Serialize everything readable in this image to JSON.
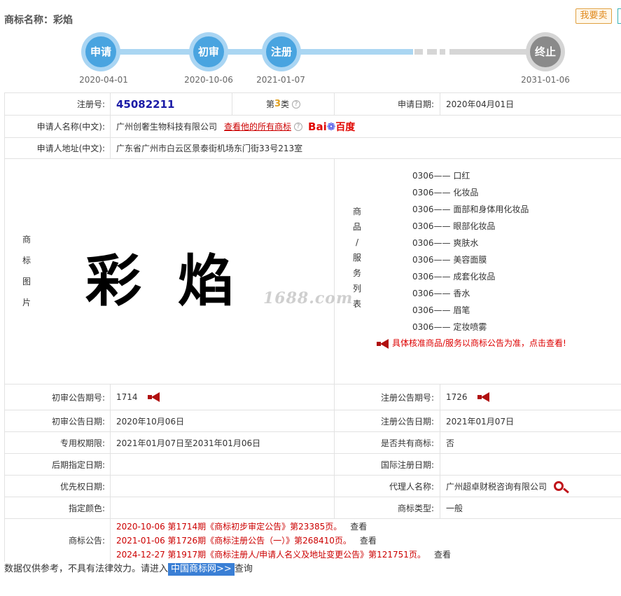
{
  "header": {
    "title": "商标名称：彩焰",
    "sell_button": "我要卖"
  },
  "timeline": {
    "steps": [
      {
        "label": "申请",
        "date": "2020-04-01"
      },
      {
        "label": "初审",
        "date": "2020-10-06"
      },
      {
        "label": "注册",
        "date": "2021-01-07"
      },
      {
        "label": "终止",
        "date": "2031-01-06"
      }
    ]
  },
  "info": {
    "reg_no_label": "注册号:",
    "reg_no": "45082211",
    "class_prefix": "第",
    "class_num": "3",
    "class_suffix": "类",
    "apply_date_label": "申请日期:",
    "apply_date": "2020年04月01日",
    "applicant_label": "申请人名称(中文):",
    "applicant": "广州创奢生物科技有限公司",
    "applicant_link": "查看他的所有商标",
    "baidu_text": "Bai",
    "baidu_cn": "百度",
    "address_label": "申请人地址(中文):",
    "address": "广东省广州市白云区景泰街机场东门街33号213室",
    "image_label_chars": [
      "商",
      "标",
      "图",
      "片"
    ],
    "trademark_text": "彩焰",
    "watermark": "1688.com",
    "goods_label_chars": [
      "商",
      "品",
      "/",
      "服",
      "务",
      "列",
      "表"
    ],
    "goods": [
      {
        "code": "0306——",
        "name": "口红"
      },
      {
        "code": "0306——",
        "name": "化妆品"
      },
      {
        "code": "0306——",
        "name": "面部和身体用化妆品"
      },
      {
        "code": "0306——",
        "name": "眼部化妆品"
      },
      {
        "code": "0306——",
        "name": "爽肤水"
      },
      {
        "code": "0306——",
        "name": "美容面膜"
      },
      {
        "code": "0306——",
        "name": "成套化妆品"
      },
      {
        "code": "0306——",
        "name": "香水"
      },
      {
        "code": "0306——",
        "name": "眉笔"
      },
      {
        "code": "0306——",
        "name": "定妆喷雾"
      }
    ],
    "goods_note": "具体核准商品/服务以商标公告为准，点击查看!",
    "prelim_no_label": "初审公告期号:",
    "prelim_no": "1714",
    "reg_notice_no_label": "注册公告期号:",
    "reg_notice_no": "1726",
    "prelim_date_label": "初审公告日期:",
    "prelim_date": "2020年10月06日",
    "reg_notice_date_label": "注册公告日期:",
    "reg_notice_date": "2021年01月07日",
    "exclusive_label": "专用权期限:",
    "exclusive": "2021年01月07日至2031年01月06日",
    "shared_label": "是否共有商标:",
    "shared": "否",
    "later_label": "后期指定日期:",
    "later": "",
    "intl_label": "国际注册日期:",
    "intl": "",
    "priority_label": "优先权日期:",
    "priority": "",
    "agent_label": "代理人名称:",
    "agent": "广州超卓财税咨询有限公司",
    "color_label": "指定颜色:",
    "color": "",
    "type_label": "商标类型:",
    "type": "一般",
    "notices_label": "商标公告:",
    "notices": [
      {
        "text": "2020-10-06 第1714期《商标初步审定公告》第23385页。",
        "view": "查看"
      },
      {
        "text": "2021-01-06 第1726期《商标注册公告（一）》第268410页。",
        "view": "查看"
      },
      {
        "text": "2024-12-27 第1917期《商标注册人/申请人名义及地址变更公告》第121751页。",
        "view": "查看"
      }
    ]
  },
  "footer": {
    "prefix": "数据仅供参考，不具有法律效力。请进入",
    "link": "中国商标网>>",
    "suffix": "查询"
  },
  "colors": {
    "accent_blue": "#49a4e0",
    "node_grey": "#8a8a8a",
    "link_red": "#c00000"
  }
}
